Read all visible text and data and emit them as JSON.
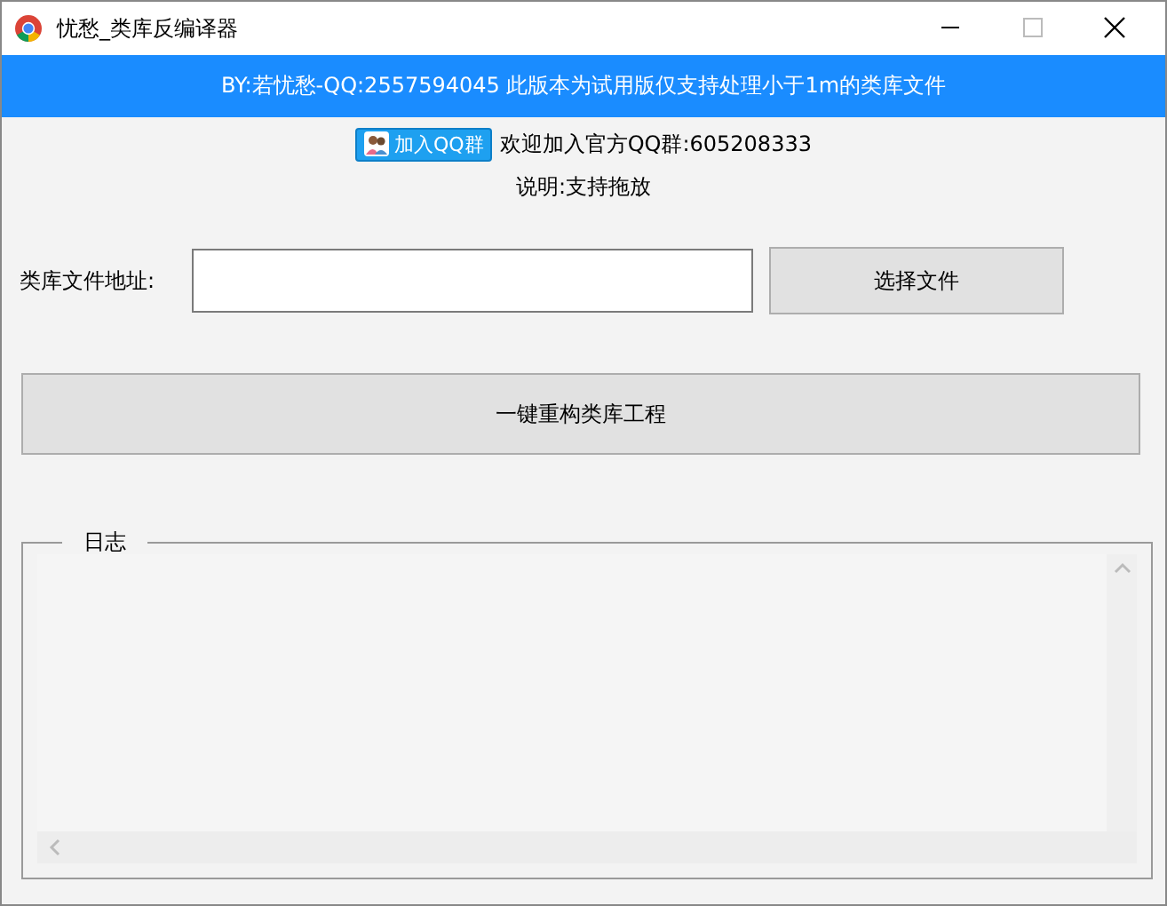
{
  "window": {
    "title": "忧愁_类库反编译器"
  },
  "banner": "BY:若忧愁-QQ:2557594045 此版本为试用版仅支持处理小于1m的类库文件",
  "qq_group": {
    "button": "加入QQ群",
    "text": "欢迎加入官方QQ群:605208333"
  },
  "note": "说明:支持拖放",
  "file_field": {
    "label": "类库文件地址:"
  },
  "choose_button": "选择文件",
  "rebuild_button": "一键重构类库工程",
  "log": {
    "title": "日志"
  }
}
